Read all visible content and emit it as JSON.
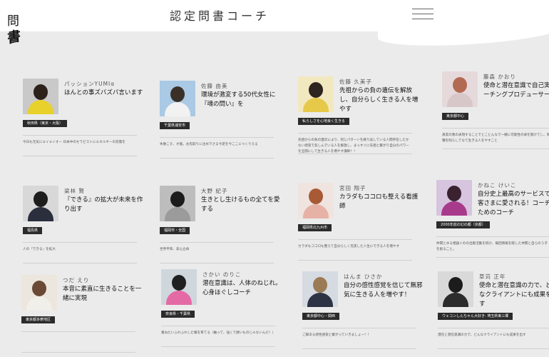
{
  "header": {
    "title": "認定問書コーチ",
    "menu_icon": "hamburger-menu-icon",
    "logo_kanji": "問",
    "logo_sig": "書"
  },
  "coaches": [
    {
      "name": "パッションYUMIα",
      "catch": "ほんとの事ズバズバ言います",
      "tag": "秋田県（東京・大阪）",
      "desc": "今日も元気にエイエイオー 日本中のセラピストにエネルギーの充電を",
      "colors": {
        "bg": "#c9c9c9",
        "hair": "#2c211b",
        "cloth": "#e8d12a"
      }
    },
    {
      "name": "佐藤 由美",
      "catch": "環境が激変する50代女性に『魂の問い』を",
      "tag": "千葉県浦安市",
      "desc": "失敗こそ、才能。お先取りに注め下さる今足を今ここにつくりえる",
      "colors": {
        "bg": "#a9c9e4",
        "hair": "#3a3028",
        "cloth": "#f2f2f2"
      }
    },
    {
      "name": "佐藤 久美子",
      "catch": "先祖からの負の遺伝を解放し、自分らしく生きる人を増やす",
      "tag": "私らしさを心地良く生きる",
      "desc": "先祖からの負の遺伝により、同じパターンを繰り返している人間存在したかない感覚で悲しんでいる人を解放し、まっすぐに先祖と繋がり自分のパワーを全開にして生きる人を増やす講師！！",
      "colors": {
        "bg": "#f2e8c0",
        "hair": "#2e2420",
        "cloth": "#e7c94a"
      }
    },
    {
      "name": "藤森 かおり",
      "catch": "使命と潜在意識で自己実現コーチングプロデューサー",
      "tag": "東京都中心",
      "desc": "真実の我の表現することでとことんなで一緒に可能性の扉を開けてし、新と種を照らしてなて生きる人をやすこと",
      "colors": {
        "bg": "#e6d9dc",
        "hair": "#b26a52",
        "cloth": "#d8c7c9"
      }
    },
    {
      "name": "梁林 賢",
      "catch": "『できる』の拡大が未来を作り出す",
      "tag": "福島県",
      "desc": "人の『できる』を拡大",
      "colors": {
        "bg": "#d8d8d8",
        "hair": "#1d1d1d",
        "cloth": "#2a2e3d"
      }
    },
    {
      "name": "大野 紀子",
      "catch": "生きとし生けるもの全てを愛する",
      "tag": "福岡市・全国",
      "desc": "世界平和、安心立命",
      "colors": {
        "bg": "#bdbdbd",
        "hair": "#1c1c1c",
        "cloth": "#9b9b9b"
      }
    },
    {
      "name": "宮田 翔子",
      "catch": "カラダもココロも整える看護師",
      "tag": "福岡県北九州市",
      "desc": "カラダもココロも整えて自分らしく充実した人生にできる人を増やす",
      "colors": {
        "bg": "#efe4df",
        "hair": "#a85a35",
        "cloth": "#e6b2a5"
      }
    },
    {
      "name": "かねこ けいこ",
      "catch": "自分史上最高のサービスでお客さまに愛される！コーチのためのコーチ",
      "tag": "2000年前の幻の都（京都）",
      "desc": "仲間とゆる相論ぐのの出版活動を続け、毎回情報を贈した仲間と自らのう子を創ること。",
      "colors": {
        "bg": "#d7c4de",
        "hair": "#3a2230",
        "cloth": "#a83a8c"
      }
    },
    {
      "name": "つだ えり",
      "catch": "本音に素直に生きることを一緒に実現",
      "tag": "東京都多摩地区",
      "desc": "",
      "colors": {
        "bg": "#ece6de",
        "hair": "#6a4a35",
        "cloth": "#f0efe9"
      }
    },
    {
      "name": "さかい のりこ",
      "catch": "潜在意識は、人体のねじれ。心身ほぐしコーチ",
      "tag": "奈良県・千葉県",
      "desc": "重ねたいふれふれした職を育てる（軸って、強くて硬いものじゃないんだ！）",
      "colors": {
        "bg": "#cfd7dc",
        "hair": "#202020",
        "cloth": "#e46aa6"
      }
    },
    {
      "name": "はんま ひさか",
      "catch": "自分の感性感覚を信じて無邪気に生きる人を増やす！",
      "tag": "東京都中心・関西",
      "desc": "ご縁ある感性感覚と繋がっていきましょー！！",
      "colors": {
        "bg": "#d6dbe2",
        "hair": "#9a7b55",
        "cloth": "#2d3345"
      }
    },
    {
      "name": "草苅 正年",
      "catch": "使命と潜在意識の力で、どんなクライアントにも成果を出す",
      "tag": "ウェコンしんちゃん大好き: 埼玉県東三郷",
      "desc": "潜在と潜在意識の力で、どんなクライアントにも成果を出す",
      "colors": {
        "bg": "#d9d9d9",
        "hair": "#1c1c1c",
        "cloth": "#2c2c2c"
      }
    }
  ]
}
